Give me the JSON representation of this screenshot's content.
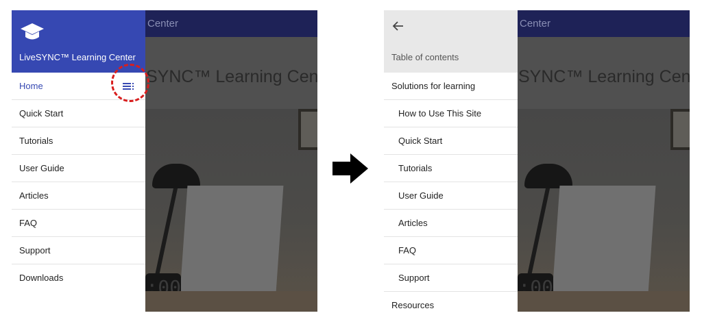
{
  "app": {
    "bar_title": "Center",
    "hero_title": "SYNC™ Learning Center",
    "hero_title_right": "SYNC™ Learning Cente"
  },
  "photo": {
    "clock_digits": ":00"
  },
  "left_drawer": {
    "brand": "LiveSYNC™ Learning Center",
    "logo_icon": "graduation-cap-icon",
    "toc_icon": "table-of-contents-icon",
    "items": [
      {
        "label": "Home",
        "active": true
      },
      {
        "label": "Quick Start"
      },
      {
        "label": "Tutorials"
      },
      {
        "label": "User Guide"
      },
      {
        "label": "Articles"
      },
      {
        "label": "FAQ"
      },
      {
        "label": "Support"
      },
      {
        "label": "Downloads"
      }
    ]
  },
  "right_drawer": {
    "back_icon": "arrow-back-icon",
    "title": "Table of contents",
    "items": [
      {
        "label": "Solutions for learning"
      },
      {
        "label": "How to Use This Site"
      },
      {
        "label": "Quick Start"
      },
      {
        "label": "Tutorials"
      },
      {
        "label": "User Guide"
      },
      {
        "label": "Articles"
      },
      {
        "label": "FAQ"
      },
      {
        "label": "Support"
      },
      {
        "label": "Resources"
      }
    ]
  },
  "annotation": {
    "highlight_color": "#d81e1e",
    "arrow_icon": "right-arrow-icon"
  },
  "colors": {
    "brand": "#3648b2",
    "app_bar": "#1e2257",
    "toc_header": "#e8e8e8"
  }
}
